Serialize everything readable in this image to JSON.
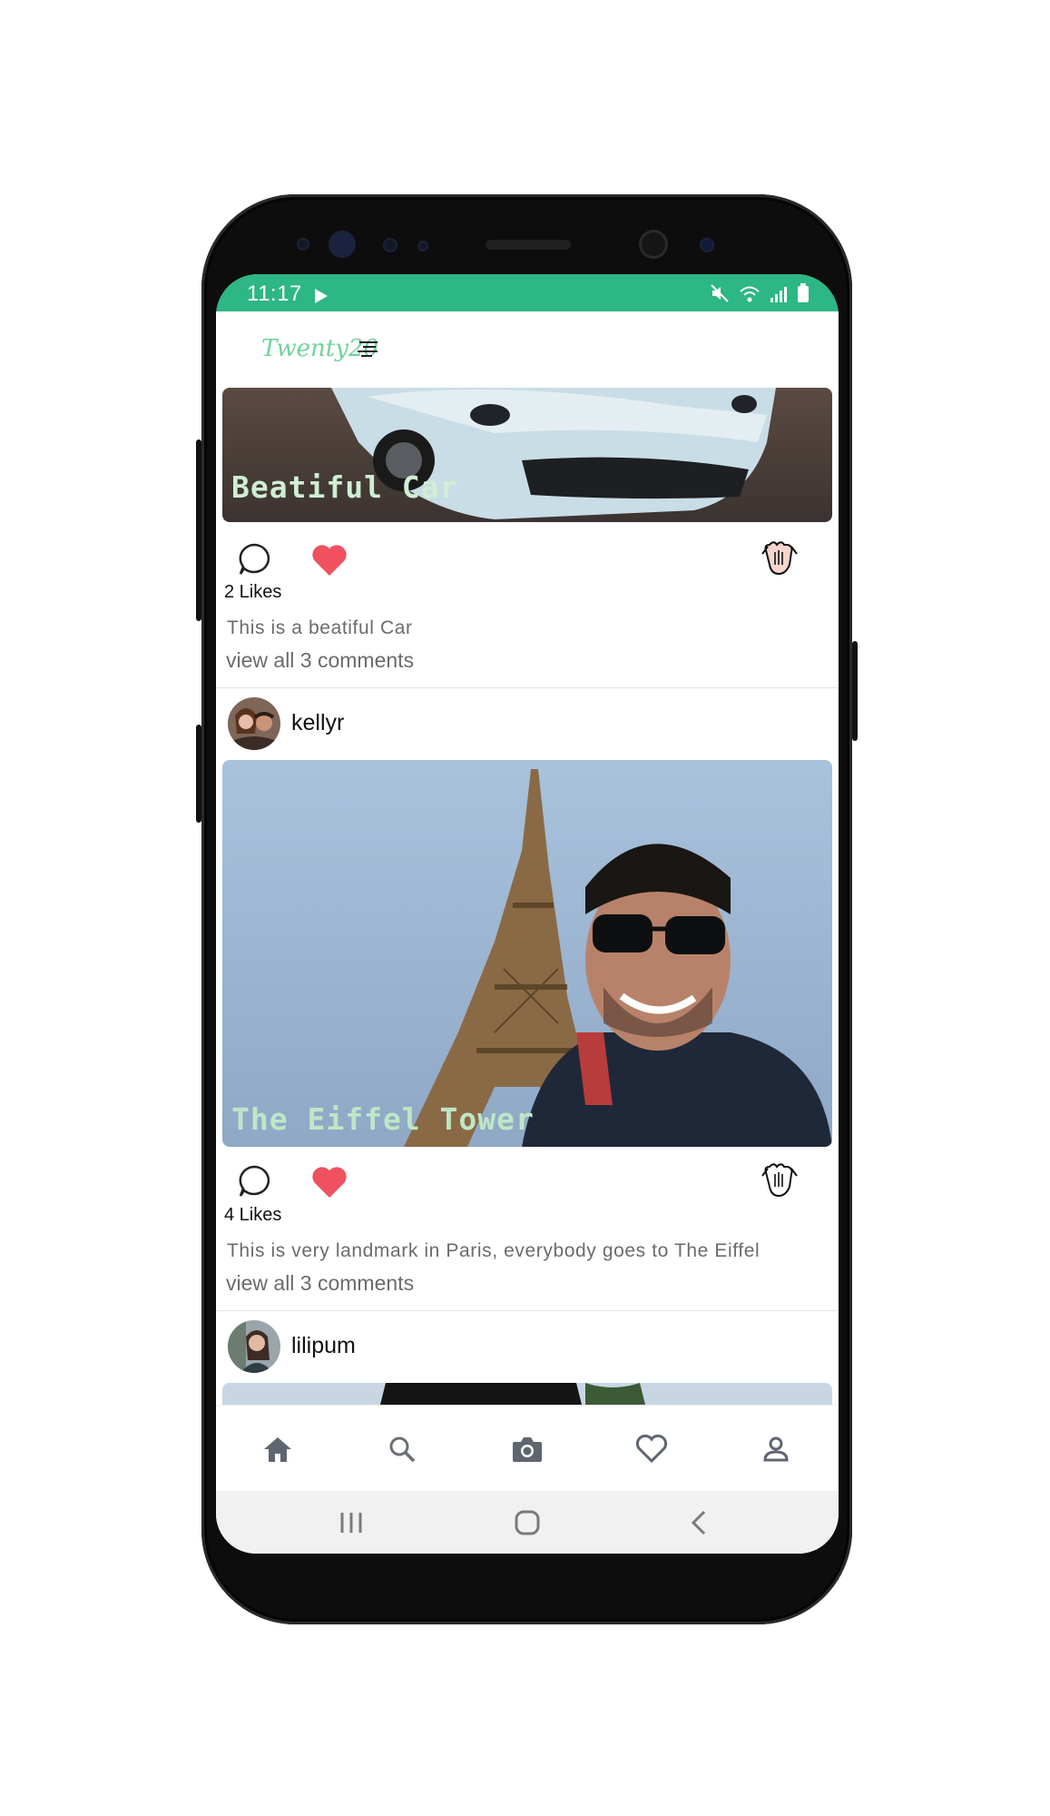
{
  "status_bar": {
    "time": "11:17",
    "background": "#2db784",
    "left_icons": [
      "play-store-icon"
    ],
    "right_icons": [
      "mute-icon",
      "wifi-icon",
      "signal-icon",
      "battery-icon"
    ]
  },
  "app_header": {
    "logo_text": "Twenty20",
    "logo_color": "#6ed39a"
  },
  "posts": [
    {
      "image_caption": "Beatiful Car",
      "likes": "2 Likes",
      "description": "This is a beatiful Car",
      "comments_link": "view all 3 comments",
      "liked": true
    },
    {
      "username": "kellyr",
      "image_caption": "The Eiffel Tower",
      "likes": "4 Likes",
      "description": "This is very landmark in Paris, everybody goes to The Eiffel",
      "comments_link": "view all 3 comments",
      "liked": true
    },
    {
      "username": "lilipum"
    }
  ],
  "bottom_nav": {
    "items": [
      "home-icon",
      "search-icon",
      "camera-icon",
      "heart-icon",
      "profile-icon"
    ],
    "active": "home-icon"
  },
  "system_nav": {
    "items": [
      "recents-icon",
      "home-circle-icon",
      "back-icon"
    ]
  },
  "colors": {
    "accent_green": "#2db784",
    "like_red": "#ef5160"
  }
}
